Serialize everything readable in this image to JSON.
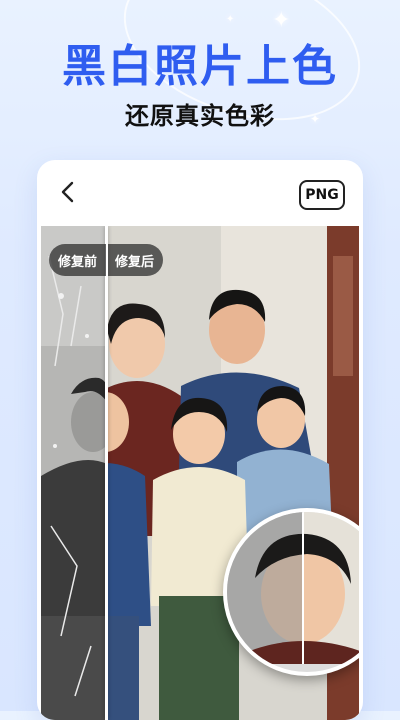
{
  "headline": "黑白照片上色",
  "subheadline": "还原真实色彩",
  "editor": {
    "png_label": "PNG",
    "before_label": "修复前",
    "after_label": "修复后"
  }
}
